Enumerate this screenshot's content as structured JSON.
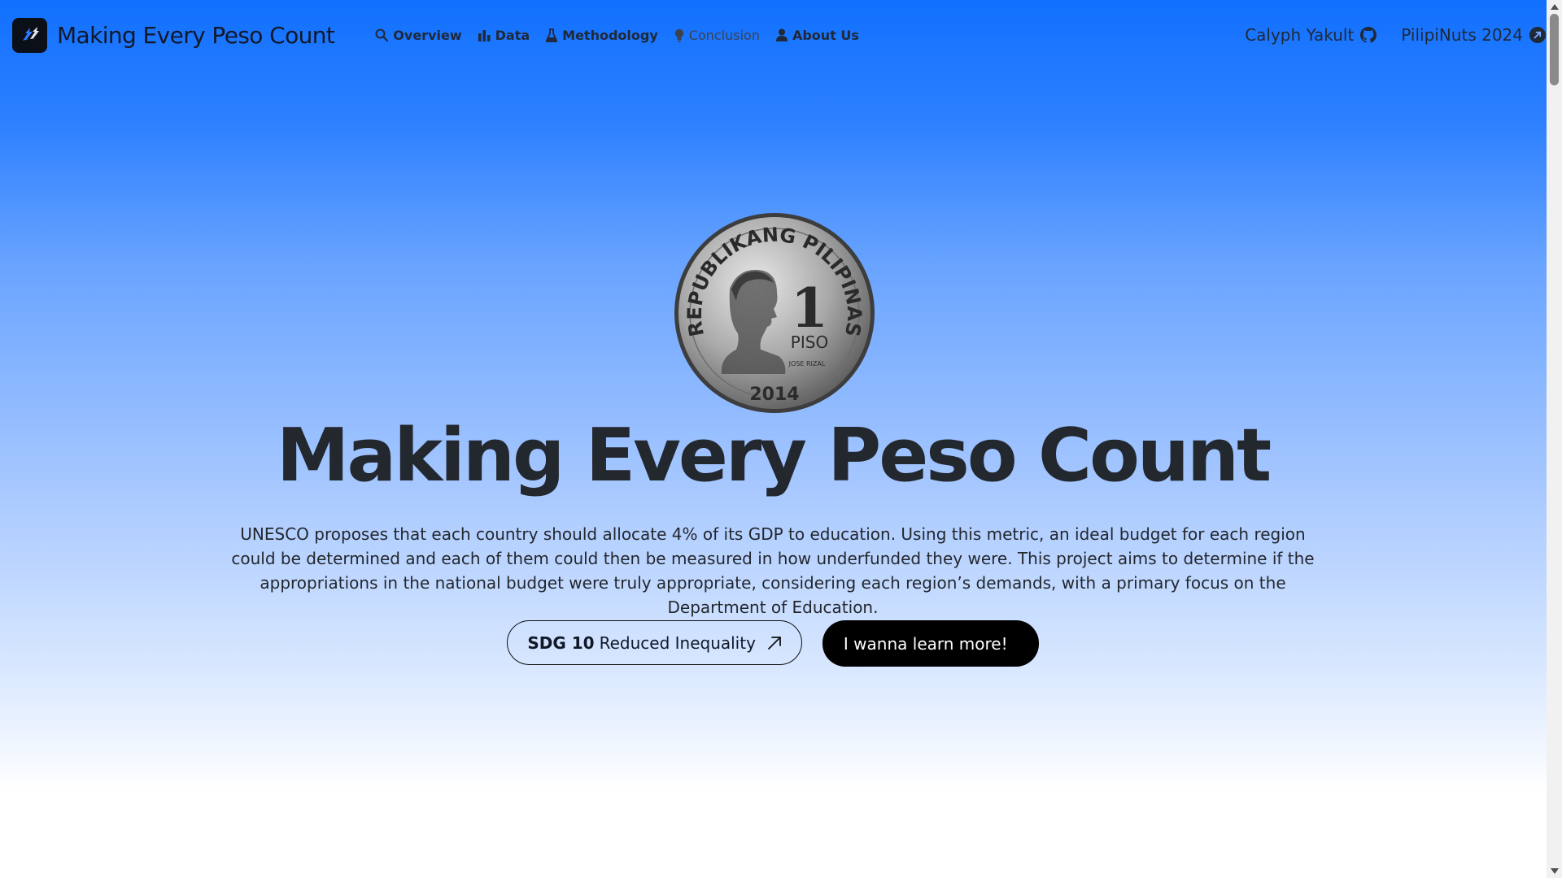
{
  "header": {
    "brand_title": "Making Every Peso Count",
    "nav": [
      {
        "label": "Overview",
        "icon": "search-icon"
      },
      {
        "label": "Data",
        "icon": "bar-chart-icon"
      },
      {
        "label": "Methodology",
        "icon": "flask-icon"
      },
      {
        "label": "Conclusion",
        "icon": "lightbulb-icon"
      },
      {
        "label": "About Us",
        "icon": "user-icon"
      }
    ],
    "right_links": [
      {
        "label": "Calyph Yakult",
        "icon": "github-icon"
      },
      {
        "label": "PilipiNuts 2024",
        "icon": "external-link-icon"
      }
    ]
  },
  "hero": {
    "coin": {
      "ring_text": "REPUBLIKANG PILIPINAS",
      "denomination": "1",
      "unit": "PISO",
      "portrait_name": "JOSE RIZAL",
      "year": "2014"
    },
    "title": "Making Every Peso Count",
    "description": "UNESCO proposes that each country should allocate 4% of its GDP to education. Using this metric, an ideal budget for each region could be determined and each of them could then be measured in how underfunded they were. This project aims to determine if the appropriations in the national budget were truly appropriate, considering each region’s demands, with a primary focus on the Department of Education.",
    "sdg_button": {
      "bold": "SDG 10",
      "label": "Reduced Inequality"
    },
    "learn_button": "I wanna learn more!"
  },
  "colors": {
    "gradient_top": "#1170ff",
    "gradient_bottom": "#ffffff",
    "text_dark": "#23272e",
    "button_dark": "#000000"
  }
}
